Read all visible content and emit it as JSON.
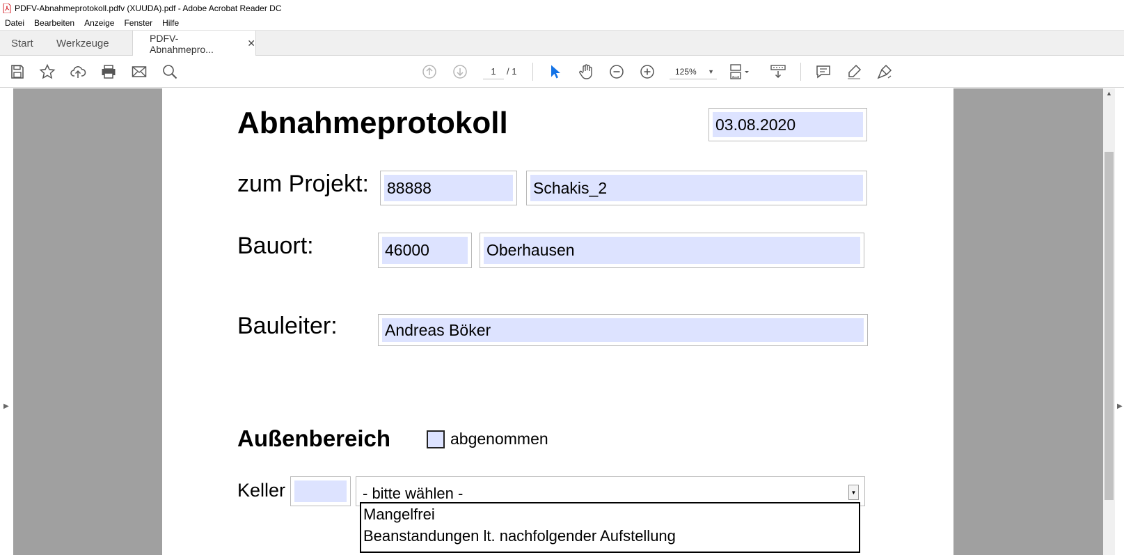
{
  "window": {
    "title": "PDFV-Abnahmeprotokoll.pdfv (XUUDA).pdf - Adobe Acrobat Reader DC"
  },
  "menu": {
    "items": [
      "Datei",
      "Bearbeiten",
      "Anzeige",
      "Fenster",
      "Hilfe"
    ]
  },
  "tabs": {
    "start": "Start",
    "tools": "Werkzeuge",
    "document": "PDFV-Abnahmepro...",
    "close_glyph": "✕"
  },
  "toolbar": {
    "page_current": "1",
    "page_total": "/ 1",
    "zoom": "125%",
    "icons": [
      "save-icon",
      "bookmark-star-icon",
      "cloud-upload-icon",
      "print-icon",
      "email-icon",
      "search-icon",
      "page-up-icon",
      "page-down-icon",
      "select-cursor-icon",
      "hand-icon",
      "zoom-out-icon",
      "zoom-in-icon",
      "page-display-icon",
      "scroll-mode-icon",
      "comment-icon",
      "highlight-icon",
      "sign-icon"
    ]
  },
  "form": {
    "title": "Abnahmeprotokoll",
    "date": "03.08.2020",
    "project_label": "zum Projekt:",
    "project_number": "88888",
    "project_name": "Schakis_2",
    "site_label": "Bauort:",
    "site_zip": "46000",
    "site_city": "Oberhausen",
    "manager_label": "Bauleiter:",
    "manager_name": "Andreas Böker",
    "section_title": "Außenbereich",
    "accepted_label": "abgenommen",
    "accepted_checked": false,
    "keller_label": "Keller",
    "keller_value": "",
    "keller_select": "- bitte wählen -",
    "keller_options": [
      "Mangelfrei",
      "Beanstandungen lt. nachfolgender Aufstellung"
    ]
  },
  "colors": {
    "field_fill": "#dde3ff",
    "viewer_gray": "#a0a0a0",
    "accent_blue": "#1473e6"
  }
}
